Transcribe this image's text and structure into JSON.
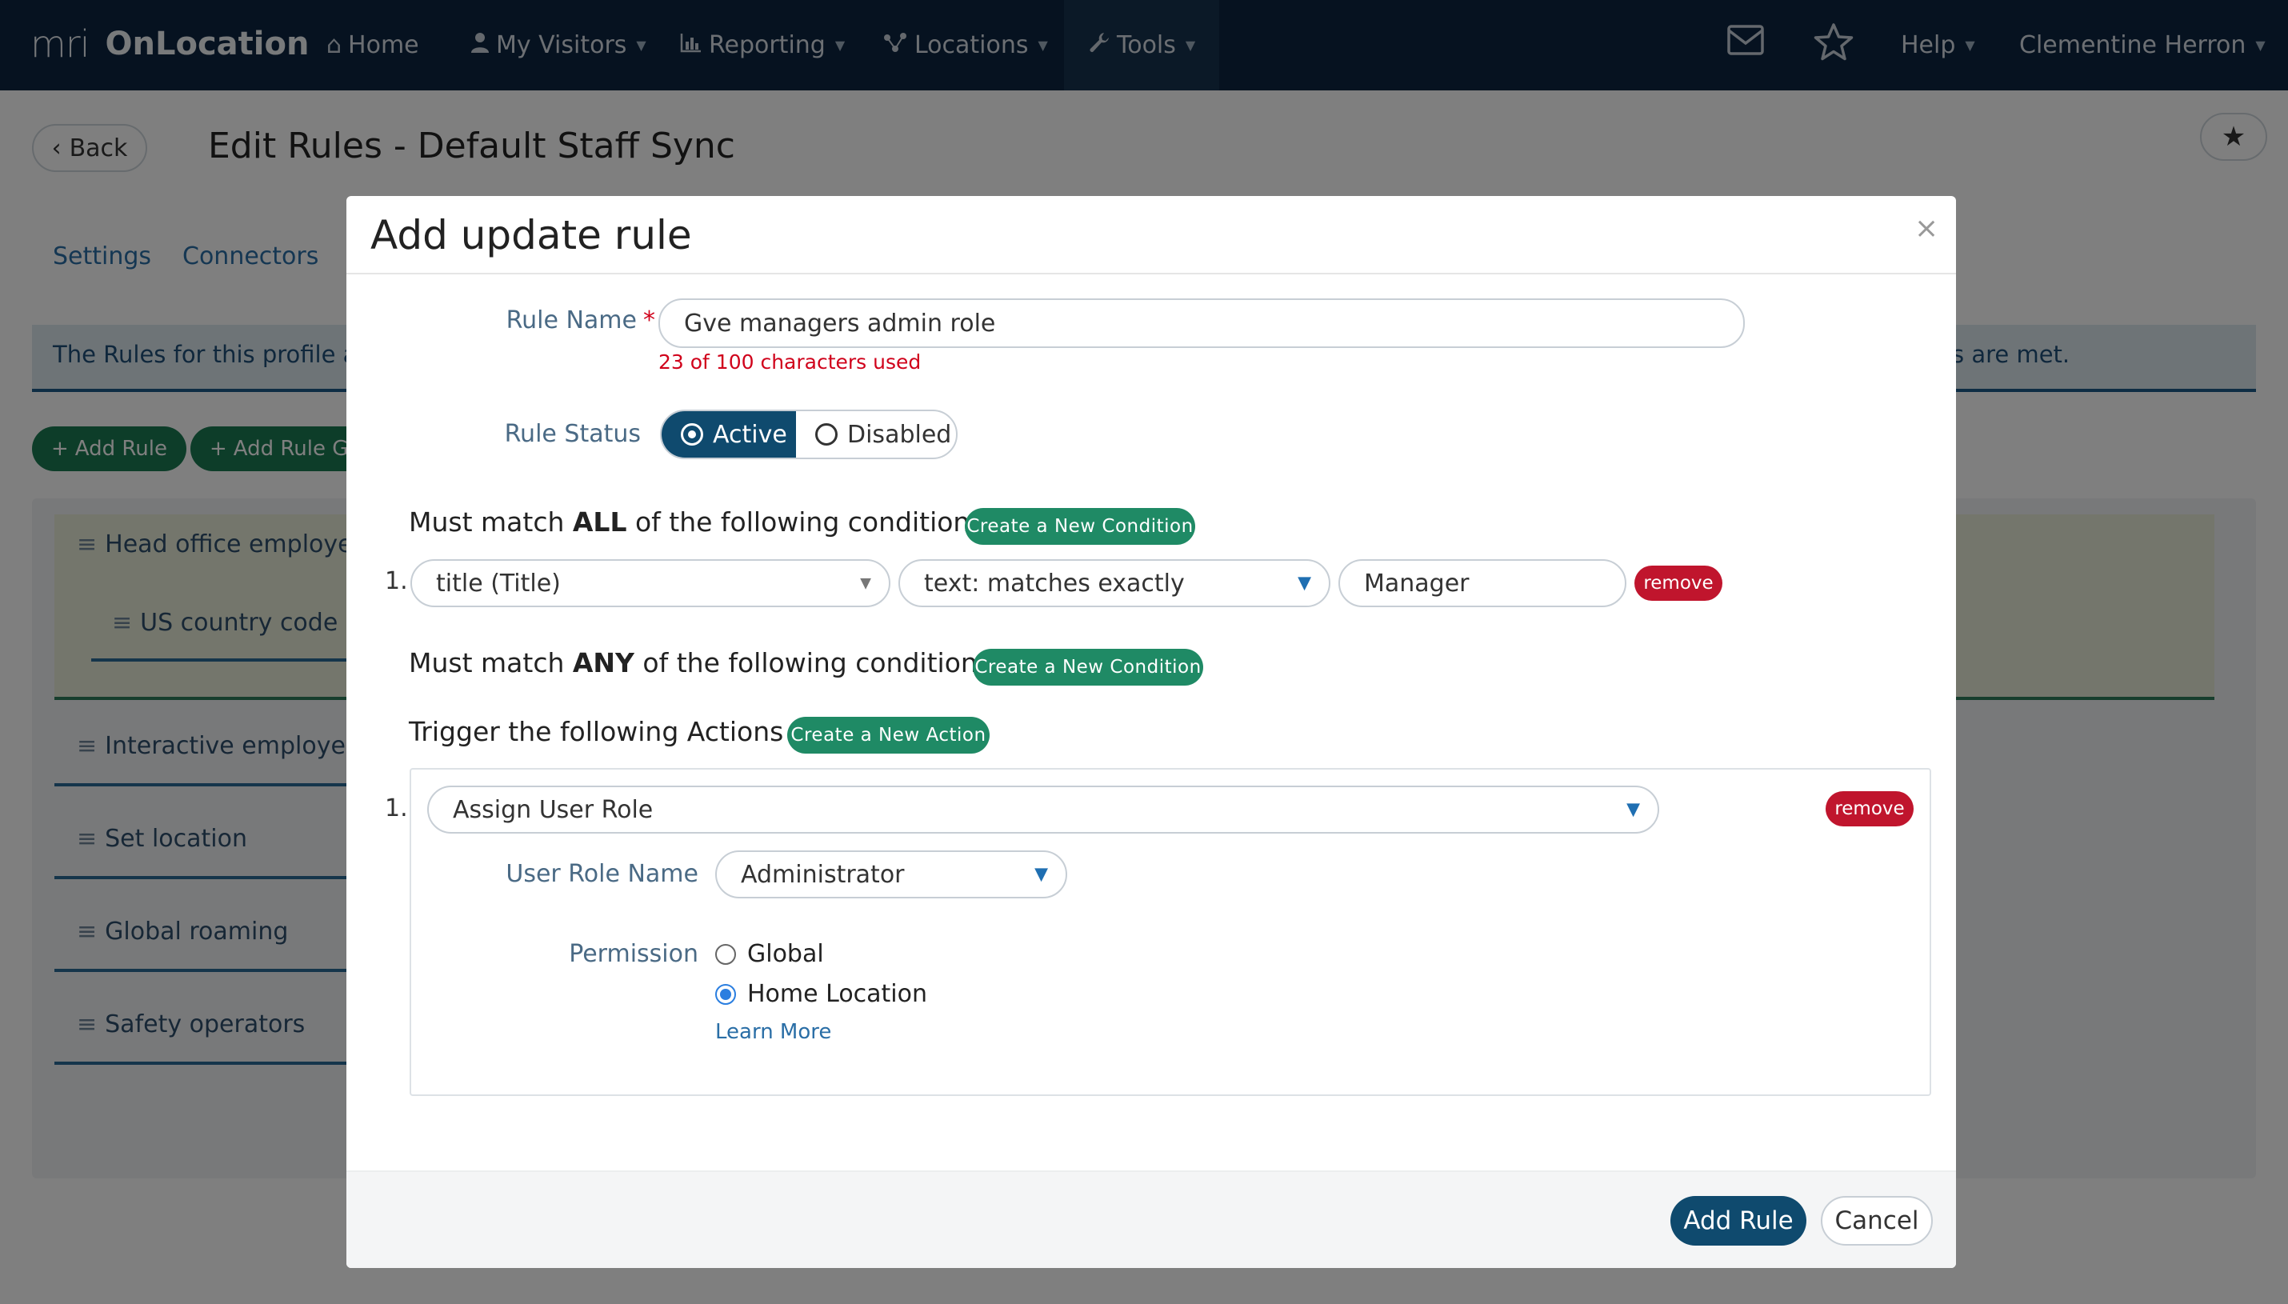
{
  "app": {
    "brand_logo": "mri",
    "brand_name": "OnLocation"
  },
  "nav": {
    "items": [
      {
        "label": "Home",
        "icon": "home-icon"
      },
      {
        "label": "My Visitors",
        "icon": "user-icon"
      },
      {
        "label": "Reporting",
        "icon": "chart-icon"
      },
      {
        "label": "Locations",
        "icon": "network-icon"
      },
      {
        "label": "Tools",
        "icon": "wrench-icon"
      }
    ],
    "help": "Help",
    "user": "Clementine Herron"
  },
  "page": {
    "back_label": "Back",
    "title": "Edit Rules - Default Staff Sync",
    "tabs": [
      "Settings",
      "Connectors"
    ],
    "info_left": "The Rules for this profile are",
    "info_right": "s are met.",
    "add_rule": "Add Rule",
    "add_rule_group": "Add Rule Gr",
    "rules": [
      "Head office employees",
      "US country code",
      "Interactive employees",
      "Set location",
      "Global roaming",
      "Safety operators"
    ]
  },
  "modal": {
    "title": "Add update rule",
    "close": "×",
    "rule_name_label": "Rule Name",
    "required_mark": "*",
    "rule_name_value": "Gve managers admin role",
    "char_count": "23 of 100 characters used",
    "rule_status_label": "Rule Status",
    "status_active": "Active",
    "status_disabled": "Disabled",
    "all_prefix": "Must match ",
    "all_keyword": "ALL",
    "all_suffix": " of the following conditions",
    "any_prefix": "Must match ",
    "any_keyword": "ANY",
    "any_suffix": " of the following conditions",
    "create_condition": "Create a New Condition",
    "conditions": [
      {
        "num": "1.",
        "field": "title (Title)",
        "operator": "text: matches exactly",
        "value": "Manager",
        "remove": "remove"
      }
    ],
    "actions_heading": "Trigger the following Actions",
    "create_action": "Create a New Action",
    "actions": [
      {
        "num": "1.",
        "type": "Assign User Role",
        "remove": "remove",
        "role_label": "User Role Name",
        "role_value": "Administrator",
        "permission_label": "Permission",
        "permission_options": [
          "Global",
          "Home Location"
        ],
        "permission_selected": "Home Location",
        "learn_more": "Learn More"
      }
    ],
    "submit": "Add Rule",
    "cancel": "Cancel"
  },
  "colors": {
    "nav_bg": "#0c2541",
    "primary": "#0f4a6e",
    "green": "#1f8a65",
    "danger": "#c0152d",
    "link": "#2a6ea6"
  }
}
